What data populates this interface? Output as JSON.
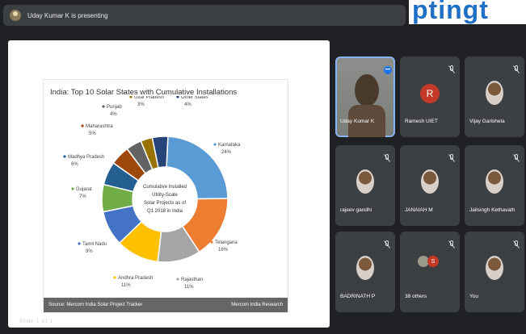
{
  "presenter_bar": {
    "text": "Uday Kumar K is presenting"
  },
  "overlay_text": "ptingt",
  "slide": {
    "footer_left": "Source: Mercom India Solar Project Tracker",
    "footer_right": "Mercom India Research",
    "bottom_watermark": "Slide 1 of 1"
  },
  "chart_data": {
    "type": "pie",
    "title": "India: Top 10 Solar States with Cumulative Installations",
    "center_label": [
      "Cumulative Installed",
      "Utility-Scale",
      "Solar Projects as of",
      "Q1 2018 in India"
    ],
    "categories": [
      "Karnataka",
      "Telangana",
      "Rajasthan",
      "Andhra Pradesh",
      "Tamil Nadu",
      "Gujarat",
      "Madhya Pradesh",
      "Maharashtra",
      "Punjab",
      "Uttar Pradesh",
      "Other States"
    ],
    "values": [
      24,
      16,
      11,
      11,
      9,
      7,
      6,
      5,
      4,
      3,
      4
    ],
    "labels": [
      "24%",
      "16%",
      "11%",
      "11%",
      "9%",
      "7%",
      "6%",
      "5%",
      "4%",
      "3%",
      "4%"
    ],
    "colors": [
      "#5b9bd5",
      "#ed7d31",
      "#a5a5a5",
      "#ffc000",
      "#4472c4",
      "#70ad47",
      "#255e91",
      "#9e480e",
      "#636363",
      "#997300",
      "#264478"
    ]
  },
  "participants": [
    {
      "name": "Uday Kumar K",
      "type": "video"
    },
    {
      "name": "Ramesh UIET",
      "type": "letter",
      "letter": "R"
    },
    {
      "name": "Vijay Garishela",
      "type": "photo"
    },
    {
      "name": "rajeev gandhi",
      "type": "photo"
    },
    {
      "name": "JANAIAH M",
      "type": "photo"
    },
    {
      "name": "Jailsingh Kethavath",
      "type": "photo"
    },
    {
      "name": "BADRINATH P",
      "type": "photo"
    },
    {
      "name": "38 others",
      "type": "group"
    },
    {
      "name": "You",
      "type": "photo"
    }
  ],
  "icons": {
    "mic_off": "mic-off-icon",
    "more": "more-options-icon"
  }
}
